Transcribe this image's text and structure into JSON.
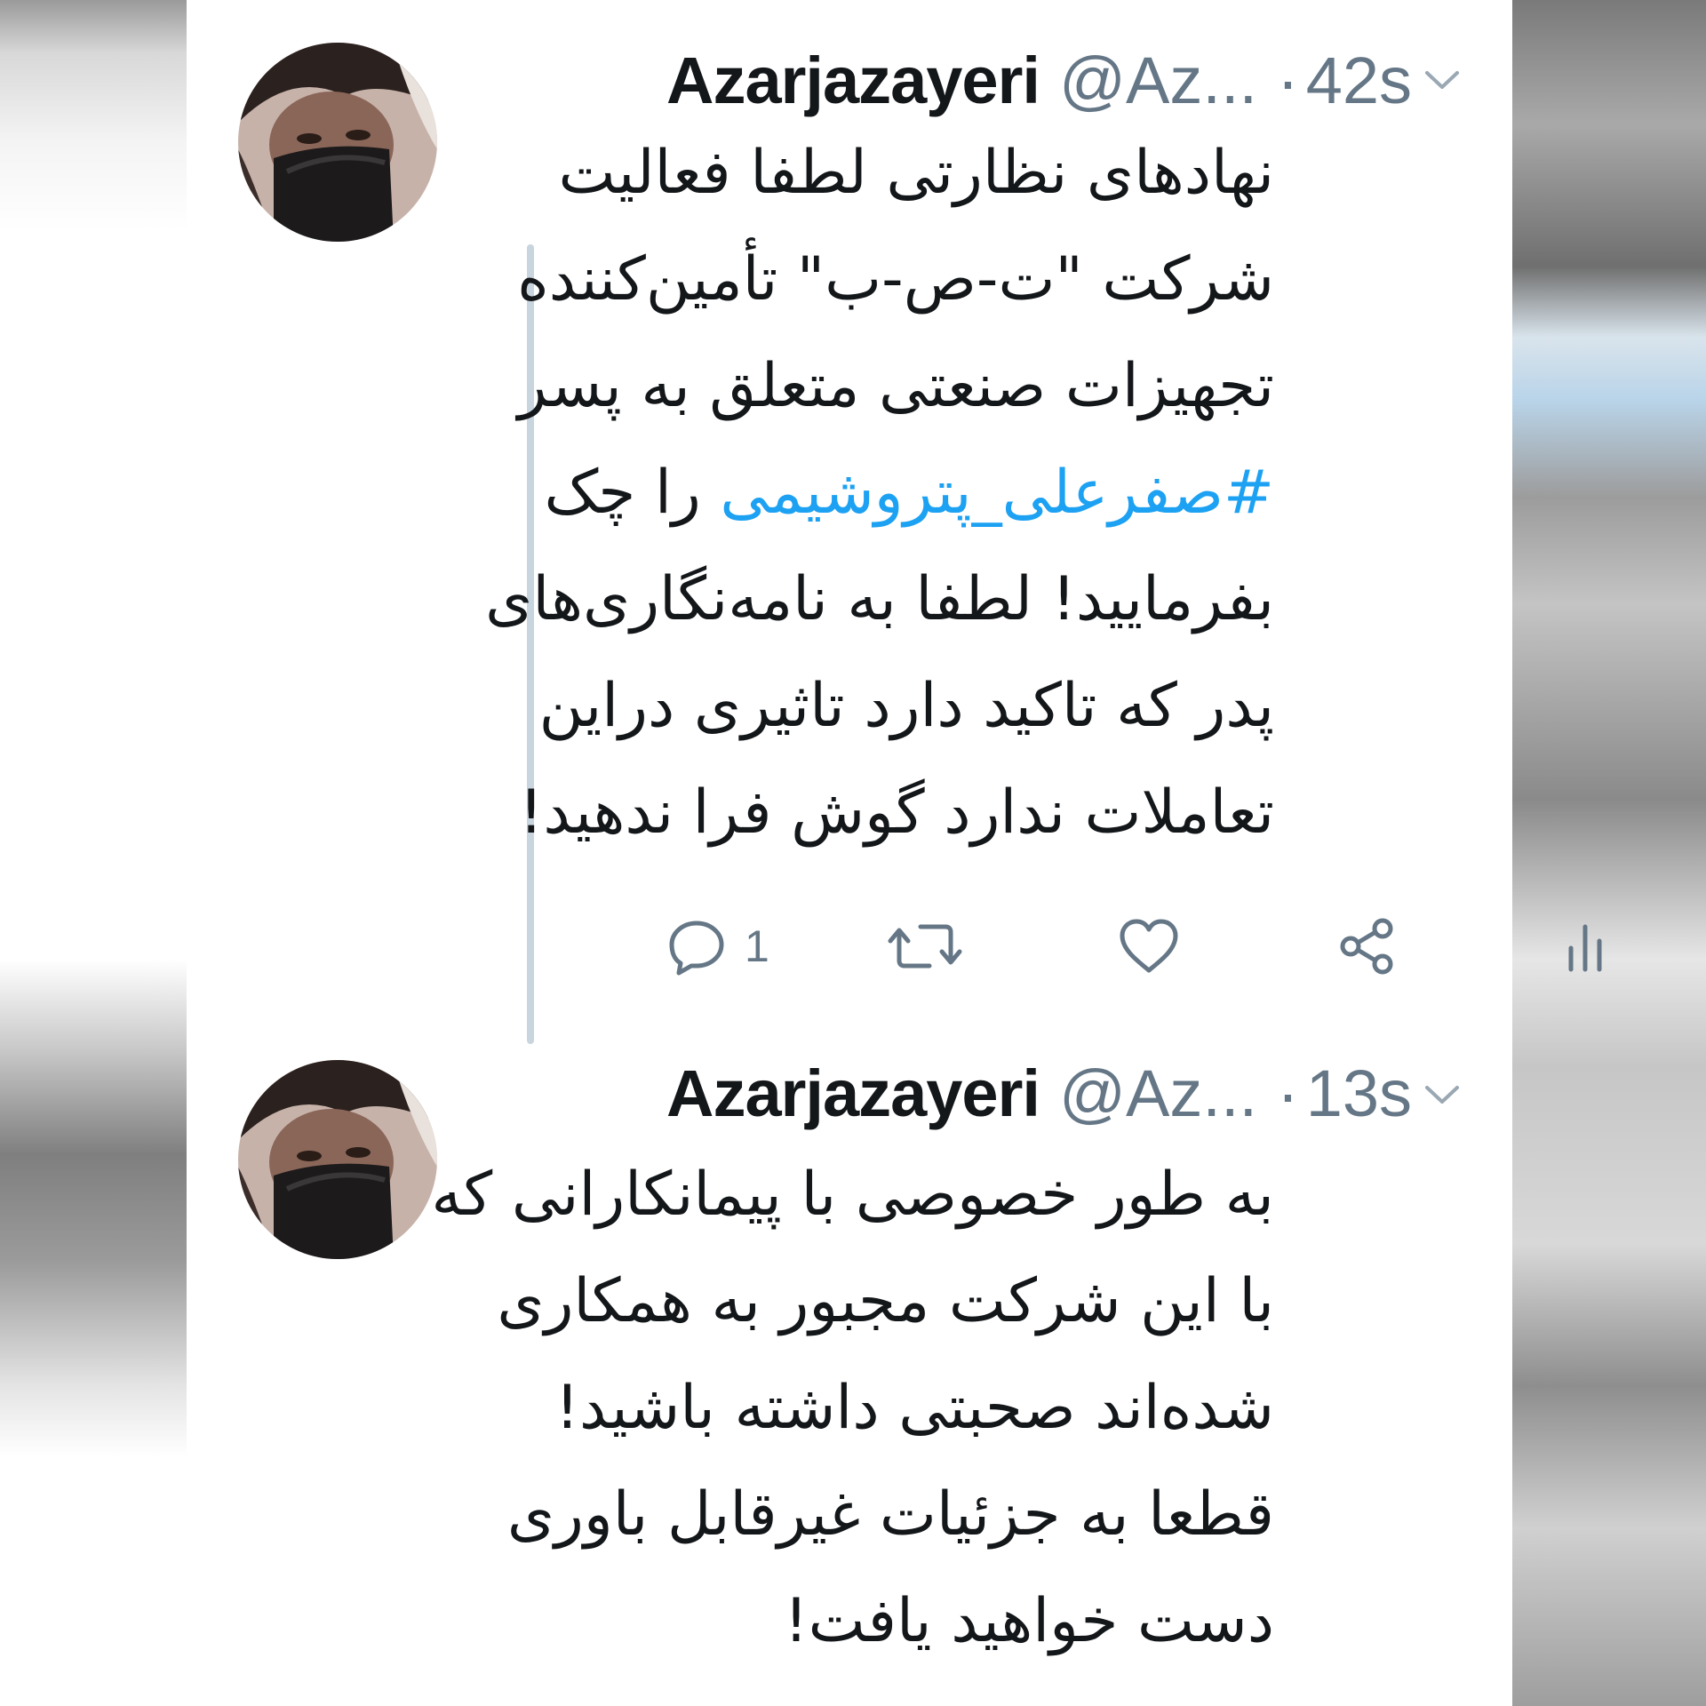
{
  "tweets": [
    {
      "name": "Azarjazayeri",
      "handle": "@Az...",
      "separator": "·",
      "time": "42s",
      "lines": [
        "نهادهای نظارتی لطفا فعالیت",
        "شرکت \"ت-ص-ب\" تأمین‌کننده",
        "تجهیزات صنعتی متعلق به پسر",
        "",
        "بفرمایید! لطفا به نامه‌نگاری‌های",
        "پدر که تاکید دارد تاثیری دراین",
        "تعاملات ندارد گوش فرا ندهید!"
      ],
      "hashtag": "#صفرعلی_پتروشیمی",
      "hashtag_suffix": "را چک",
      "reply_count": "1"
    },
    {
      "name": "Azarjazayeri",
      "handle": "@Az...",
      "separator": "·",
      "time": "13s",
      "lines": [
        "به طور خصوصی با پیمانکارانی که",
        "با این شرکت مجبور به همکاری",
        "شده‌اند صحبتی داشته باشید!",
        "قطعا به جزئیات غیرقابل باوری",
        "دست خواهید یافت!"
      ]
    }
  ],
  "icons": {
    "reply": "reply-icon",
    "retweet": "retweet-icon",
    "like": "heart-icon",
    "share": "share-icon",
    "analytics": "analytics-icon",
    "menu": "chevron-down-icon"
  },
  "colors": {
    "text": "#14171a",
    "secondary": "#657786",
    "hashtag": "#1da1f2",
    "thread_line": "#c9d5de"
  }
}
